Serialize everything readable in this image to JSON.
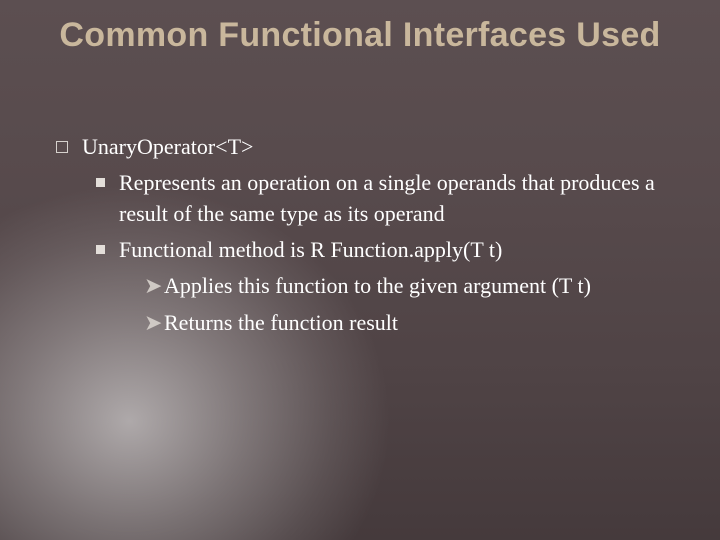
{
  "title": "Common Functional Interfaces Used",
  "bullets": {
    "l1": "UnaryOperator<T>",
    "l2a": "Represents an operation on a single operands that produces a result of the same type as its operand",
    "l2b": "Functional method is R Function.apply(T t)",
    "l3a": "Applies this function to the given argument (T t)",
    "l3b": "Returns the function result"
  }
}
